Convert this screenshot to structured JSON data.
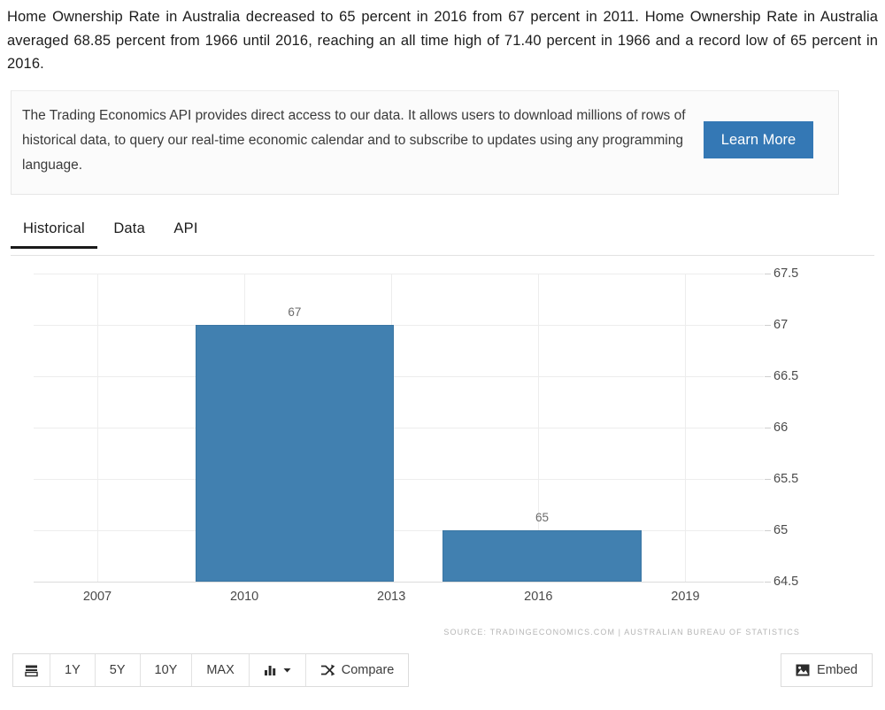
{
  "intro": {
    "text": "Home Ownership Rate in Australia decreased to 65 percent in 2016 from 67 percent in 2011. Home Ownership Rate in Australia averaged 68.85 percent from 1966 until 2016, reaching an all time high of 71.40 percent in 1966 and a record low of 65 percent in 2016."
  },
  "promo": {
    "text": "The Trading Economics API provides direct access to our data. It allows users to download millions of rows of historical data, to query our real-time economic calendar and to subscribe to updates using any programming language.",
    "button_label": "Learn More",
    "button_color": "#3478b5"
  },
  "tabs": [
    {
      "label": "Historical",
      "active": true
    },
    {
      "label": "Data",
      "active": false
    },
    {
      "label": "API",
      "active": false
    }
  ],
  "toolbar": {
    "menu_icon": "list-icon",
    "ranges": [
      "1Y",
      "5Y",
      "10Y",
      "MAX"
    ],
    "chart_type_icon": "bar-chart-icon",
    "chart_type_caret": "chevron-down-icon",
    "compare_icon": "shuffle-icon",
    "compare_label": "Compare",
    "embed_icon": "image-icon",
    "embed_label": "Embed"
  },
  "chart_data": {
    "type": "bar",
    "title": "",
    "xlabel": "",
    "ylabel": "",
    "categories": [
      "2011",
      "2016"
    ],
    "values": [
      67,
      65
    ],
    "data_labels": [
      "67",
      "65"
    ],
    "bar_color": "#4180b0",
    "ylim": [
      64.5,
      67.5
    ],
    "yticks": [
      67.5,
      67,
      66.5,
      66,
      65.5,
      65,
      64.5
    ],
    "ytick_labels": [
      "67.5",
      "67",
      "66.5",
      "66",
      "65.5",
      "65",
      "64.5"
    ],
    "xticks": [
      2007,
      2010,
      2013,
      2016,
      2019
    ],
    "xtick_labels": [
      "2007",
      "2010",
      "2013",
      "2016",
      "2019"
    ],
    "xlim": [
      2005.7,
      2020.6
    ],
    "bars": [
      {
        "category": "2011",
        "value": 67,
        "label": "67",
        "x_start": 2009.0,
        "x_end": 2013.05
      },
      {
        "category": "2016",
        "value": 65,
        "label": "65",
        "x_start": 2014.05,
        "x_end": 2018.1
      }
    ],
    "grid": true,
    "legend": false,
    "source": "SOURCE: TRADINGECONOMICS.COM | AUSTRALIAN BUREAU OF STATISTICS"
  }
}
